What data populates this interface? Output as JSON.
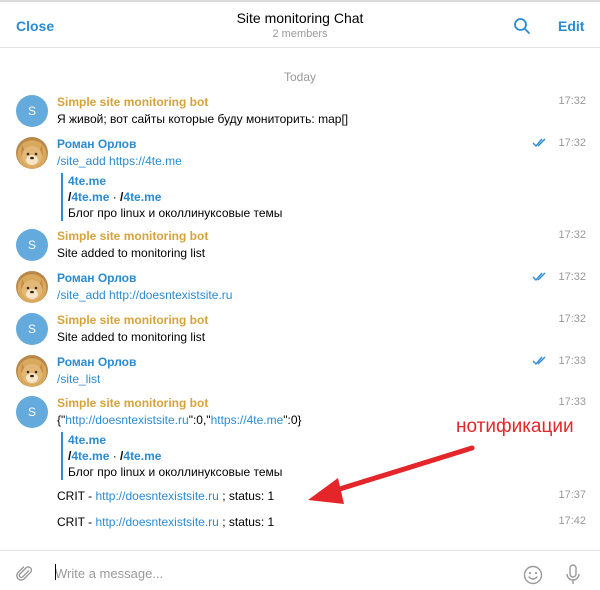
{
  "header": {
    "close_label": "Close",
    "title": "Site monitoring Chat",
    "subtitle": "2 members",
    "edit_label": "Edit",
    "search_icon": "search-icon"
  },
  "date_separator": "Today",
  "bot": {
    "name": "Simple site monitoring bot",
    "avatar_letter": "S",
    "avatar_color": "#65aadd",
    "name_color": "#d6a33a"
  },
  "user": {
    "name": "Роман Орлов",
    "name_color": "#2a8bd3"
  },
  "messages": [
    {
      "sender": "Simple site monitoring bot",
      "time": "17:32",
      "text": "Я живой; вот сайты которые буду мониторить: map[]"
    },
    {
      "sender": "Роман Орлов",
      "time": "17:32",
      "command": "/site_add",
      "link": "https://4te.me",
      "preview": {
        "title": "4te.me",
        "slash": "/",
        "site1": "4te.me",
        "sep": " · ",
        "slash2": "/",
        "site2": "4te.me",
        "desc": "Блог про linux и околлинуксовые темы"
      }
    },
    {
      "sender": "Simple site monitoring bot",
      "time": "17:32",
      "text": "Site added to monitoring list"
    },
    {
      "sender": "Роман Орлов",
      "time": "17:32",
      "command": "/site_add",
      "link": "http://doesntexistsite.ru"
    },
    {
      "sender": "Simple site monitoring bot",
      "time": "17:32",
      "text": "Site added to monitoring list"
    },
    {
      "sender": "Роман Орлов",
      "time": "17:33",
      "command": "/site_list"
    },
    {
      "sender": "Simple site monitoring bot",
      "time": "17:33",
      "json_open": "{\"",
      "json_link1": "http://doesntexistsite.ru",
      "json_mid": "\":0,\"",
      "json_link2": "https://4te.me",
      "json_close": "\":0}",
      "preview": {
        "title": "4te.me",
        "slash": "/",
        "site1": "4te.me",
        "sep": " · ",
        "slash2": "/",
        "site2": "4te.me",
        "desc": "Блог про linux и околлинуксовые темы"
      }
    }
  ],
  "crit_lines": [
    {
      "prefix": "CRIT - ",
      "link": "http://doesntexistsite.ru",
      "suffix": " ; status: 1",
      "time": "17:37"
    },
    {
      "prefix": "CRIT - ",
      "link": "http://doesntexistsite.ru",
      "suffix": " ; status: 1",
      "time": "17:42"
    }
  ],
  "annotation": {
    "text": "нотификации",
    "color": "#e4262a"
  },
  "composer": {
    "placeholder": "Write a message...",
    "value": ""
  },
  "colors": {
    "accent": "#2a8bd3",
    "bot_name": "#d6a33a",
    "annotation": "#e4262a"
  }
}
